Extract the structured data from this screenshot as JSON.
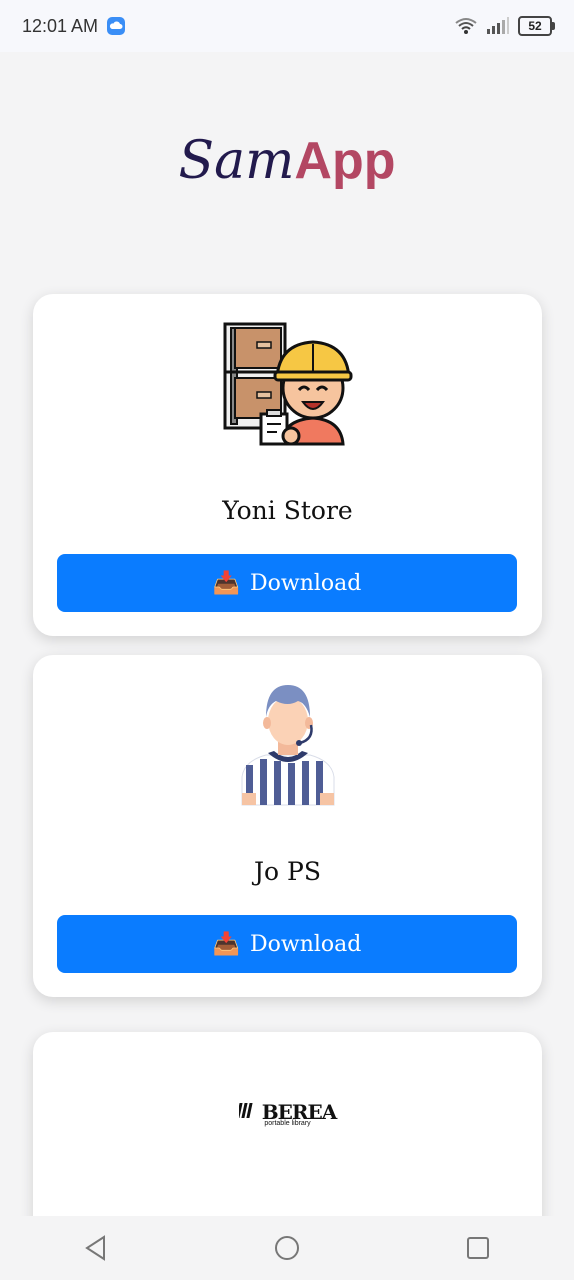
{
  "status_bar": {
    "time": "12:01 AM",
    "battery": "52"
  },
  "logo": {
    "part1": "Sam",
    "part2": "App"
  },
  "apps": [
    {
      "name": "Yoni Store",
      "button_label": "Download",
      "button_icon": "inbox-tray-icon"
    },
    {
      "name": "Jo PS",
      "button_label": "Download",
      "button_icon": "inbox-tray-icon"
    },
    {
      "logo_text": "BEREA",
      "logo_subtext": "portable library"
    }
  ],
  "colors": {
    "button": "#0a7cff",
    "brand_dark": "#221a4d",
    "brand_accent": "#b34763"
  }
}
